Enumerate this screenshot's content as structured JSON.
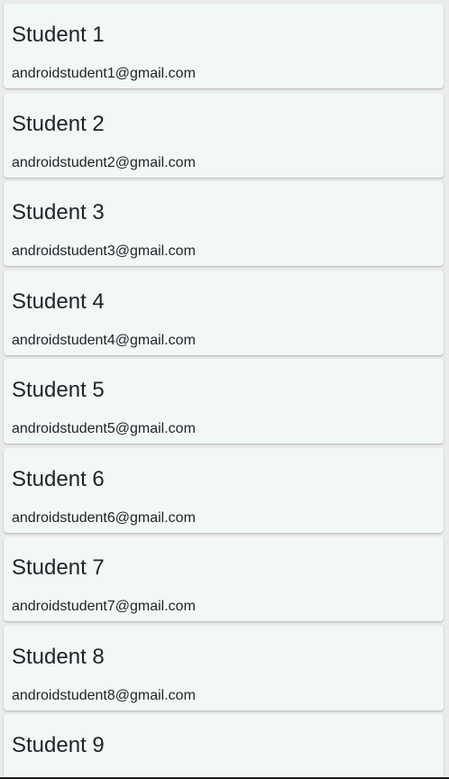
{
  "students": [
    {
      "name": "Student 1",
      "email": "androidstudent1@gmail.com"
    },
    {
      "name": "Student 2",
      "email": "androidstudent2@gmail.com"
    },
    {
      "name": "Student 3",
      "email": "androidstudent3@gmail.com"
    },
    {
      "name": "Student 4",
      "email": "androidstudent4@gmail.com"
    },
    {
      "name": "Student 5",
      "email": "androidstudent5@gmail.com"
    },
    {
      "name": "Student 6",
      "email": "androidstudent6@gmail.com"
    },
    {
      "name": "Student 7",
      "email": "androidstudent7@gmail.com"
    },
    {
      "name": "Student 8",
      "email": "androidstudent8@gmail.com"
    },
    {
      "name": "Student 9",
      "email": ""
    }
  ],
  "colors": {
    "background": "#ebebeb",
    "card": "#f1f8f6",
    "text": "#1f2428"
  }
}
